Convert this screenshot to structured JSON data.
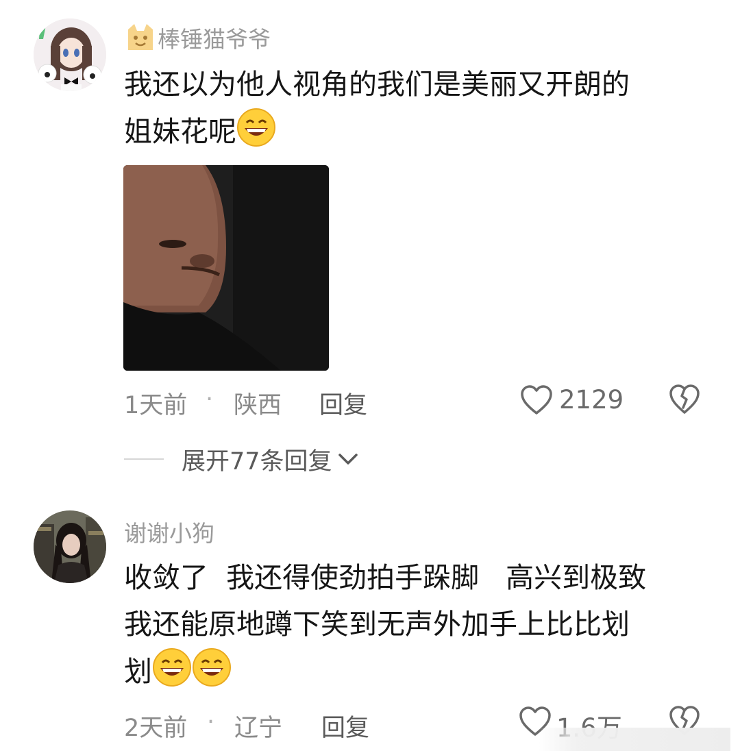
{
  "comments": [
    {
      "username": "棒锤猫爷爷",
      "username_icon": "cat-emoji-icon",
      "text_lines": [
        "我还以为他人视角的我们是美丽又开朗的",
        "姐妹花呢"
      ],
      "emoji": "grin-emoji-icon",
      "attached_image": "man-in-black-turtleneck-photo",
      "time": "1天前",
      "separator": "·",
      "location": "陕西",
      "reply_label": "回复",
      "likes": "2129",
      "expand_label": "展开77条回复"
    },
    {
      "username": "谢谢小狗",
      "text_lines": [
        "收敛了  我还得使劲拍手跺脚   高兴到极致",
        "我还能原地蹲下笑到无声外加手上比比划",
        "划"
      ],
      "emoji": "grin-emoji-icon",
      "time": "2天前",
      "separator": "·",
      "location": "辽宁",
      "reply_label": "回复",
      "likes": "1.6万"
    }
  ],
  "colors": {
    "text": "#161616",
    "muted": "#9a9a9a",
    "icon": "#6a6a6a"
  }
}
